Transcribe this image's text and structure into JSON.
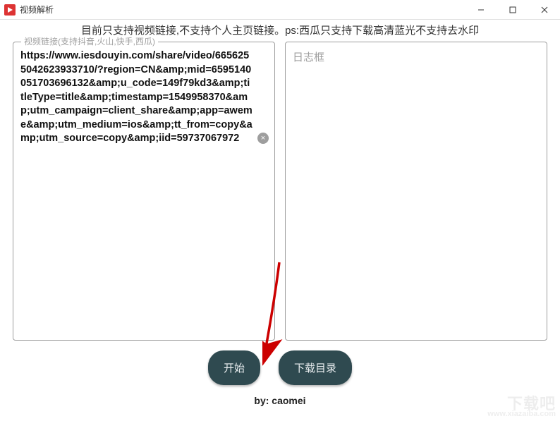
{
  "titlebar": {
    "title": "视频解析"
  },
  "notice": "目前只支持视频链接,不支持个人主页链接。ps:西瓜只支持下载高清蓝光不支持去水印",
  "inputPanel": {
    "label": "视频链接(支持抖音,火山,快手,西瓜)",
    "value": "https://www.iesdouyin.com/share/video/6656255042623933710/?region=CN&amp;mid=6595140051703696132&amp;u_code=149f79kd3&amp;titleType=title&amp;timestamp=1549958370&amp;utm_campaign=client_share&amp;app=aweme&amp;utm_medium=ios&amp;tt_from=copy&amp;utm_source=copy&amp;iid=59737067972",
    "clearIcon": "×"
  },
  "logPanel": {
    "placeholder": "日志框"
  },
  "buttons": {
    "start": "开始",
    "downloadDir": "下载目录"
  },
  "credit": "by: caomei",
  "colors": {
    "buttonBg": "#2f4a50",
    "labelGray": "#9e9e9e",
    "arrow": "#cc0000"
  },
  "watermark": {
    "main": "下载吧",
    "sub": "www.xiazaiba.com"
  }
}
